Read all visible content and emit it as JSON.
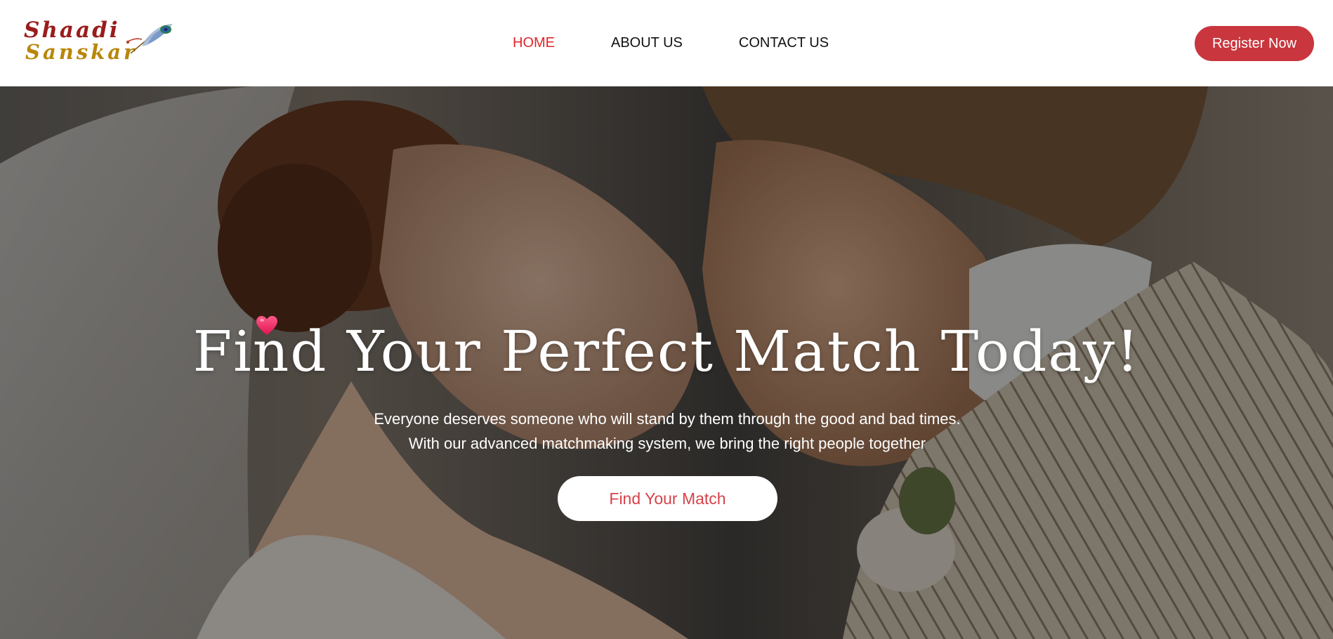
{
  "brand": {
    "logo_line1": "Shaadi",
    "logo_line2": "Sanskar",
    "logo_color_1": "#9b1c1c",
    "logo_color_2": "#b8860b"
  },
  "nav": {
    "items": [
      {
        "label": "HOME",
        "active": true
      },
      {
        "label": "ABOUT US",
        "active": false
      },
      {
        "label": "CONTACT US",
        "active": false
      }
    ],
    "active_color": "#e0262b"
  },
  "header": {
    "register_label": "Register Now",
    "register_color": "#c9363d"
  },
  "hero": {
    "title": "Find Your Perfect Match Today!",
    "subtitle": "Everyone deserves someone who will stand by them through the good and bad times. With our advanced matchmaking system, we bring the right people together",
    "cta_label": "Find Your Match",
    "cta_text_color": "#d6424a",
    "heart_icon": "heart-icon"
  }
}
